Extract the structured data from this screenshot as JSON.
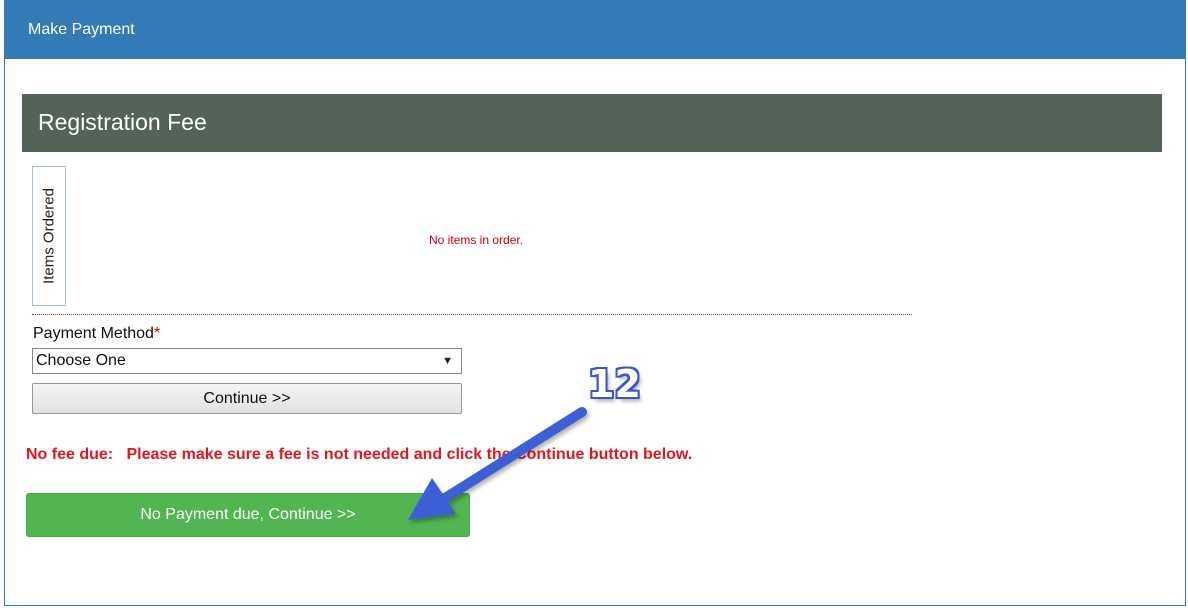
{
  "panel": {
    "title": "Make Payment"
  },
  "section": {
    "title": "Registration Fee"
  },
  "items": {
    "tab_label": "Items Ordered",
    "empty_message": "No items in order."
  },
  "payment_method": {
    "label": "Payment Method",
    "required_mark": "*",
    "selected": "Choose One",
    "continue_label": "Continue >>"
  },
  "fee_message": "No fee due:   Please make sure a fee is not needed and click the Continue button below.",
  "no_payment_button": "No Payment due, Continue >>",
  "annotation": {
    "step_number": "12",
    "arrow_color": "#3d5fd6"
  },
  "colors": {
    "header_blue": "#337ab7",
    "section_bar": "#546357",
    "error_red": "#e3161d",
    "success_green": "#52b551"
  }
}
